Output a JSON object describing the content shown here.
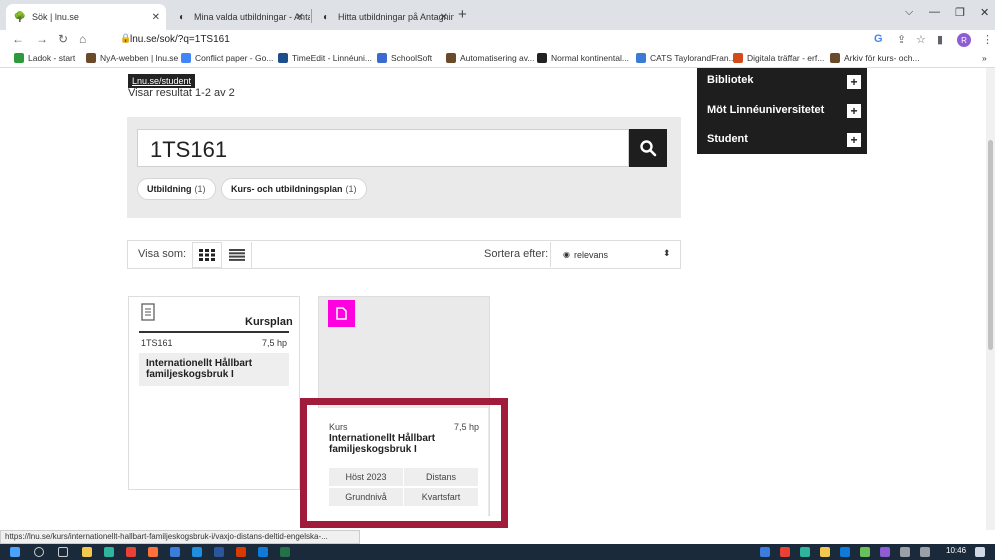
{
  "browser": {
    "tabs": [
      {
        "title": "Sök | lnu.se",
        "active": true
      },
      {
        "title": "Mina valda utbildningar - Antagn",
        "active": false
      },
      {
        "title": "Hitta utbildningar på Antagning.s",
        "active": false
      }
    ],
    "url": "lnu.se/sok/?q=1TS161",
    "profile_initial": "R",
    "bookmarks": [
      {
        "label": "Ladok - start",
        "color": "#2e9b3a"
      },
      {
        "label": "NyA-webben | lnu.se",
        "color": "#6b4a2a"
      },
      {
        "label": "Conflict paper - Go...",
        "color": "#4285f4"
      },
      {
        "label": "TimeEdit - Linnéuni...",
        "color": "#1f4e8c"
      },
      {
        "label": "SchoolSoft",
        "color": "#3b6bd1"
      },
      {
        "label": "Automatisering av...",
        "color": "#6b4a2a"
      },
      {
        "label": "Normal kontinental...",
        "color": "#222222"
      },
      {
        "label": "CATS TaylorandFran...",
        "color": "#3a7bd5"
      },
      {
        "label": "Digitala träffar - erf...",
        "color": "#d44a1a"
      },
      {
        "label": "Arkiv för kurs- och...",
        "color": "#6b4a2a"
      }
    ]
  },
  "page": {
    "tooltip": "Lnu.se/student",
    "results_count": "Visar resultat 1-2 av 2",
    "search": {
      "query": "1TS161"
    },
    "filters": [
      {
        "label": "Utbildning",
        "count": "(1)"
      },
      {
        "label": "Kurs- och utbildningsplan",
        "count": "(1)"
      }
    ],
    "view": {
      "label": "Visa som:",
      "sort_label": "Sortera efter:",
      "sort_value": "relevans"
    },
    "card_plan": {
      "type": "Kursplan",
      "code": "1TS161",
      "credits": "7,5 hp",
      "title": "Internationellt Hållbart familjeskogsbruk I"
    },
    "card_course": {
      "type": "Kurs",
      "credits": "7,5 hp",
      "title": "Internationellt Hållbart familjeskogsbruk I",
      "term": "Höst 2023",
      "mode": "Distans",
      "level": "Grundnivå",
      "pace": "Kvartsfart",
      "accent_color": "#ff00e1",
      "highlight_color": "#a11b3a"
    },
    "menu": [
      {
        "label": "Bibliotek"
      },
      {
        "label": "Möt Linnéuniversitetet"
      },
      {
        "label": "Student"
      }
    ],
    "status_url": "https://lnu.se/kurs/internationellt-hallbart-familjeskogsbruk-i/vaxjo-distans-deltid-engelska-..."
  },
  "taskbar": {
    "time": "10:46"
  }
}
